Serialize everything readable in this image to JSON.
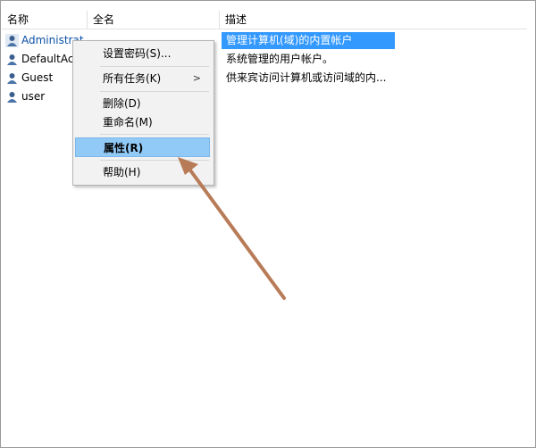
{
  "columns": {
    "name": "名称",
    "fullname": "全名",
    "description": "描述"
  },
  "users": [
    {
      "name": "Administrat",
      "description": "管理计算机(域)的内置帐户",
      "selected": true
    },
    {
      "name": "DefaultAcc",
      "description": "系统管理的用户帐户。",
      "selected": false
    },
    {
      "name": "Guest",
      "description": "供来宾访问计算机或访问域的内...",
      "selected": false
    },
    {
      "name": "user",
      "description": "",
      "selected": false
    }
  ],
  "context_menu": {
    "set_password": "设置密码(S)...",
    "all_tasks": "所有任务(K)",
    "submenu_arrow": ">",
    "delete": "删除(D)",
    "rename": "重命名(M)",
    "properties": "属性(R)",
    "help": "帮助(H)"
  },
  "colors": {
    "selection": "#3399ff",
    "menu_highlight": "#91c9f7",
    "annotation_arrow": "#b87b57"
  },
  "icons": {
    "user": "user-icon"
  }
}
